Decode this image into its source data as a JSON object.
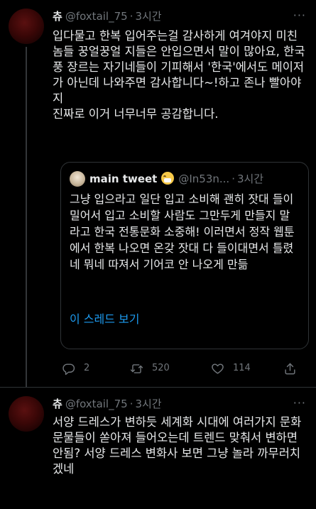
{
  "tweet1": {
    "name": "츄",
    "handle": "@foxtail_75",
    "time": "3시간",
    "more": "···",
    "body": "입다물고 한복 입어주는걸 감사하게 여겨야지 미친놈들 꿍얼꿍얼 지들은 안입으면서 말이 많아요, 한국풍 장르는 자기네들이 기피해서 '한국'에서도 메이저가 아닌데 나와주면 감사합니다~!하고 존나 빨아야지\n진짜로 이거 너무너무 공감합니다.",
    "quote": {
      "name": "main tweet",
      "handle": "@In53n...",
      "time": "3시간",
      "body": "그냥 입으라고 일단 입고 소비해 괜히 잣대 들이밀어서 입고 소비할 사람도 그만두게 만들지 말라고 한국 전통문화 소중해! 이러면서 정작 웹툰에서 한복 나오면 온갖 잣대 다 들이대면서 틀렸네 뭐네 따져서 기어코 안 나오게 만듦",
      "show_thread": "이 스레드 보기"
    },
    "actions": {
      "reply_icon": "reply-icon",
      "reply_count": "2",
      "retweet_icon": "retweet-icon",
      "retweet_count": "520",
      "like_icon": "heart-icon",
      "like_count": "114",
      "share_icon": "share-icon"
    }
  },
  "tweet2": {
    "name": "츄",
    "handle": "@foxtail_75",
    "time": "3시간",
    "more": "···",
    "body": "서양 드레스가 변하듯 세계화 시대에 여러가지 문화 문물들이 쏟아져 들어오는데 트렌드 맞춰서 변하면 안됨? 서양 드레스 변화사 보면 그냥 놀라 까무러치겠네"
  },
  "colors": {
    "background": "#000000",
    "text": "#e7e9ea",
    "muted": "#71767b",
    "link": "#1d9bf0",
    "border": "#2f3336"
  }
}
